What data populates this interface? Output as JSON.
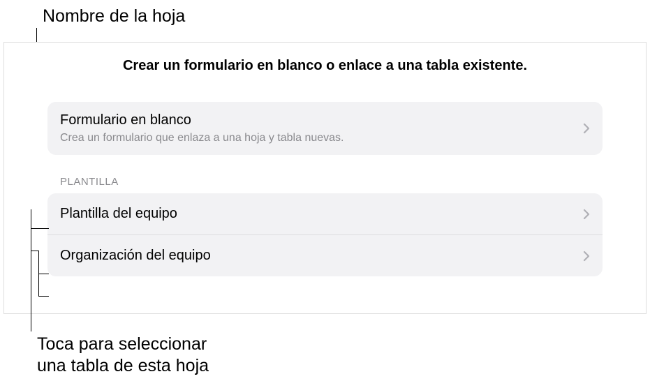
{
  "callouts": {
    "top": "Nombre de la hoja",
    "bottom": "Toca para seleccionar\nuna tabla de esta hoja"
  },
  "panel": {
    "title": "Crear un formulario en blanco o enlace a una tabla existente."
  },
  "blankForm": {
    "title": "Formulario en blanco",
    "subtitle": "Crea un formulario que enlaza a una hoja y tabla nuevas."
  },
  "sectionHeader": "PLANTILLA",
  "templates": [
    {
      "label": "Plantilla del equipo"
    },
    {
      "label": "Organización del equipo"
    }
  ]
}
